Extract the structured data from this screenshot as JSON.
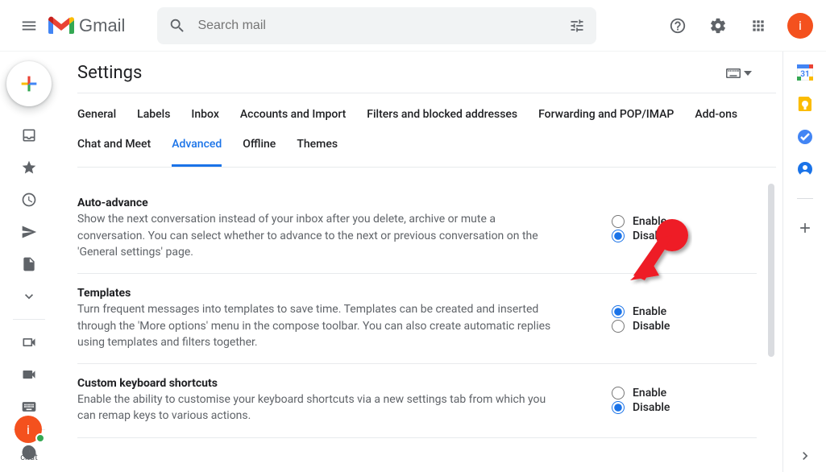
{
  "header": {
    "app_name": "Gmail",
    "search_placeholder": "Search mail",
    "avatar_initial": "i"
  },
  "sidebar": {
    "chat_label": "chat"
  },
  "main": {
    "title": "Settings",
    "tabs": [
      {
        "label": "General"
      },
      {
        "label": "Labels"
      },
      {
        "label": "Inbox"
      },
      {
        "label": "Accounts and Import"
      },
      {
        "label": "Filters and blocked addresses"
      },
      {
        "label": "Forwarding and POP/IMAP"
      },
      {
        "label": "Add-ons"
      },
      {
        "label": "Chat and Meet"
      },
      {
        "label": "Advanced",
        "active": true
      },
      {
        "label": "Offline"
      },
      {
        "label": "Themes"
      }
    ],
    "enable_label": "Enable",
    "disable_label": "Disable",
    "settings": [
      {
        "name": "Auto-advance",
        "desc": "Show the next conversation instead of your inbox after you delete, archive or mute a conversation. You can select whether to advance to the next or previous conversation on the 'General settings' page.",
        "value": "disable"
      },
      {
        "name": "Templates",
        "desc": "Turn frequent messages into templates to save time. Templates can be created and inserted through the 'More options' menu in the compose toolbar. You can also create automatic replies using templates and filters together.",
        "value": "enable"
      },
      {
        "name": "Custom keyboard shortcuts",
        "desc": "Enable the ability to customise your keyboard shortcuts via a new settings tab from which you can remap keys to various actions.",
        "value": "disable"
      }
    ]
  },
  "hangout": {
    "avatar_initial": "i"
  }
}
